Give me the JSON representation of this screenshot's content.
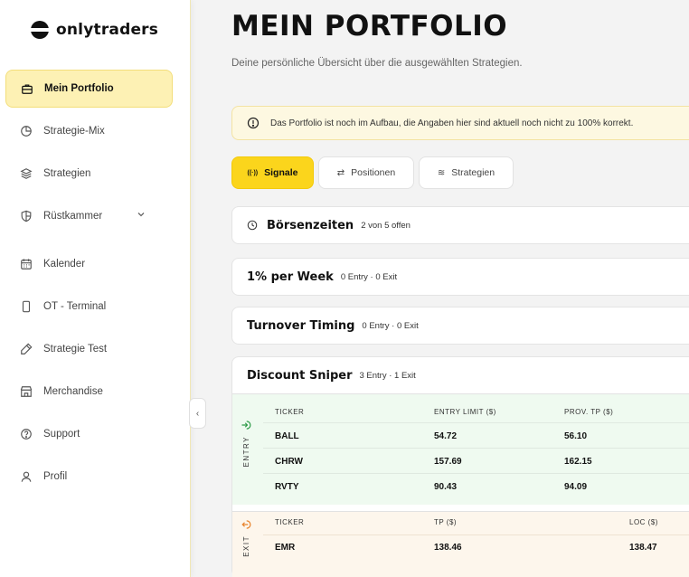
{
  "app": {
    "logo_text": "onlytraders"
  },
  "sidebar": {
    "items": [
      {
        "label": "Mein Portfolio",
        "icon": "briefcase-icon",
        "active": true
      },
      {
        "label": "Strategie-Mix",
        "icon": "pie-chart-icon"
      },
      {
        "label": "Strategien",
        "icon": "layers-icon"
      },
      {
        "label": "Rüstkammer",
        "icon": "shield-icon",
        "has_submenu": true
      },
      {
        "label": "Kalender",
        "icon": "calendar-icon"
      },
      {
        "label": "OT - Terminal",
        "icon": "phone-icon"
      },
      {
        "label": "Strategie Test",
        "icon": "flask-icon"
      },
      {
        "label": "Merchandise",
        "icon": "store-icon"
      },
      {
        "label": "Support",
        "icon": "help-circle-icon"
      },
      {
        "label": "Profil",
        "icon": "user-icon"
      }
    ],
    "collapse_glyph": "‹"
  },
  "header": {
    "title": "MEIN PORTFOLIO",
    "subtitle": "Deine persönliche Übersicht über die ausgewählten Strategien."
  },
  "alert": {
    "text": "Das Portfolio ist noch im Aufbau, die Angaben hier sind aktuell noch nicht zu 100% korrekt."
  },
  "tabs": [
    {
      "label": "Signale",
      "glyph": "((·))",
      "active": true
    },
    {
      "label": "Positionen",
      "glyph": "⇄"
    },
    {
      "label": "Strategien",
      "glyph": "≋"
    }
  ],
  "market_hours": {
    "title": "Börsenzeiten",
    "meta": "2 von 5 offen"
  },
  "strategies": [
    {
      "title": "1% per Week",
      "meta": "0 Entry · 0 Exit"
    },
    {
      "title": "Turnover Timing",
      "meta": "0 Entry · 0 Exit"
    },
    {
      "title": "Discount Sniper",
      "meta": "3 Entry · 1 Exit",
      "entry": {
        "label": "ENTRY",
        "headers": [
          "TICKER",
          "ENTRY LIMIT ($)",
          "PROV. TP ($)"
        ],
        "rows": [
          [
            "BALL",
            "54.72",
            "56.10"
          ],
          [
            "CHRW",
            "157.69",
            "162.15"
          ],
          [
            "RVTY",
            "90.43",
            "94.09"
          ]
        ]
      },
      "exit": {
        "label": "EXIT",
        "headers": [
          "TICKER",
          "TP ($)",
          "LOC ($)"
        ],
        "rows": [
          [
            "EMR",
            "138.46",
            "138.47"
          ]
        ]
      }
    }
  ],
  "colors": {
    "accent": "#fbd51c",
    "active_nav_bg": "#fdf1b4",
    "entry_bg": "#effaf0",
    "exit_bg": "#fdf6ec",
    "entry_icon": "#2e9b48",
    "exit_icon": "#e8822a"
  }
}
